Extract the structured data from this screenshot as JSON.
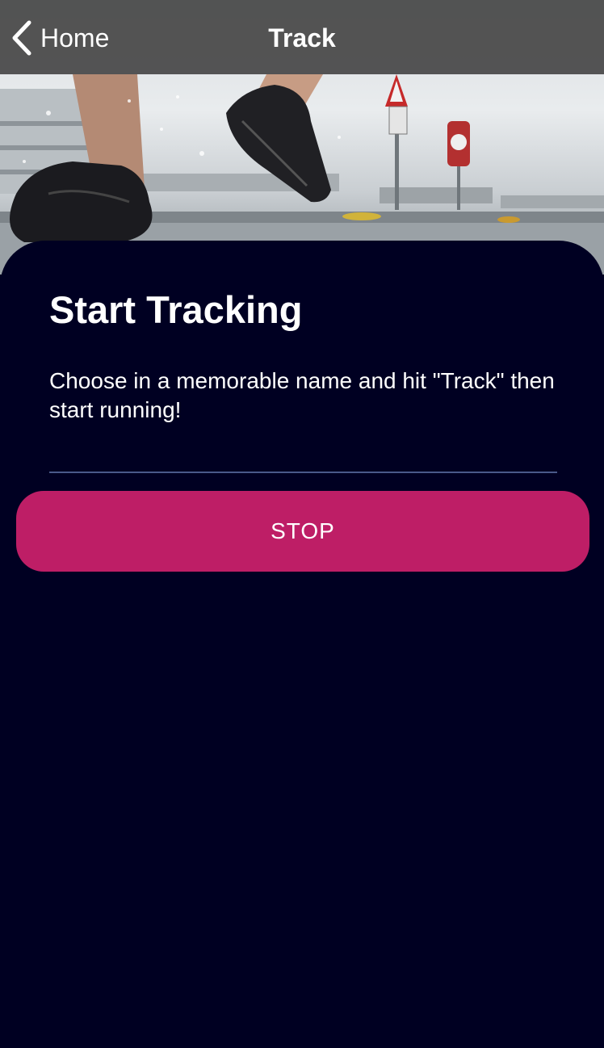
{
  "nav": {
    "back_label": "Home",
    "title": "Track"
  },
  "hero": {
    "image": "runner-photo"
  },
  "main": {
    "heading": "Start Tracking",
    "description": "Choose in a memorable name and hit \"Track\" then start running!",
    "name_input_value": "",
    "name_input_placeholder": "",
    "stop_label": "STOP"
  },
  "colors": {
    "background": "#000022",
    "navbar": "#464646",
    "accent": "#be1e66",
    "input_underline": "#4a5a8a",
    "text": "#ffffff"
  },
  "icons": {
    "back": "chevron-left-icon"
  }
}
